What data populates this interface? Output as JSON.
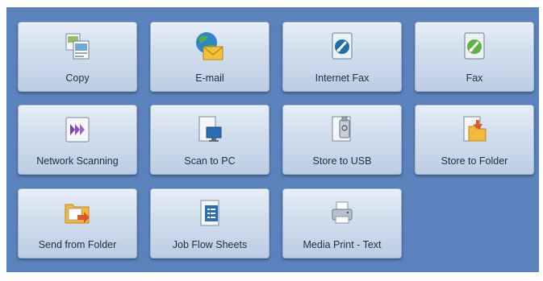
{
  "tiles": [
    {
      "label": "Copy",
      "icon": "copy-icon"
    },
    {
      "label": "E-mail",
      "icon": "email-icon"
    },
    {
      "label": "Internet Fax",
      "icon": "internet-fax-icon"
    },
    {
      "label": "Fax",
      "icon": "fax-icon"
    },
    {
      "label": "Network Scanning",
      "icon": "network-scanning-icon"
    },
    {
      "label": "Scan to PC",
      "icon": "scan-to-pc-icon"
    },
    {
      "label": "Store to USB",
      "icon": "store-to-usb-icon"
    },
    {
      "label": "Store to Folder",
      "icon": "store-to-folder-icon"
    },
    {
      "label": "Send from Folder",
      "icon": "send-from-folder-icon"
    },
    {
      "label": "Job Flow Sheets",
      "icon": "job-flow-sheets-icon"
    },
    {
      "label": "Media Print - Text",
      "icon": "media-print-text-icon"
    }
  ],
  "colors": {
    "panel_background": "#5b82bd",
    "tile_top": "#e6eef8",
    "tile_bottom": "#bccde3",
    "label_text": "#1f2d45"
  }
}
